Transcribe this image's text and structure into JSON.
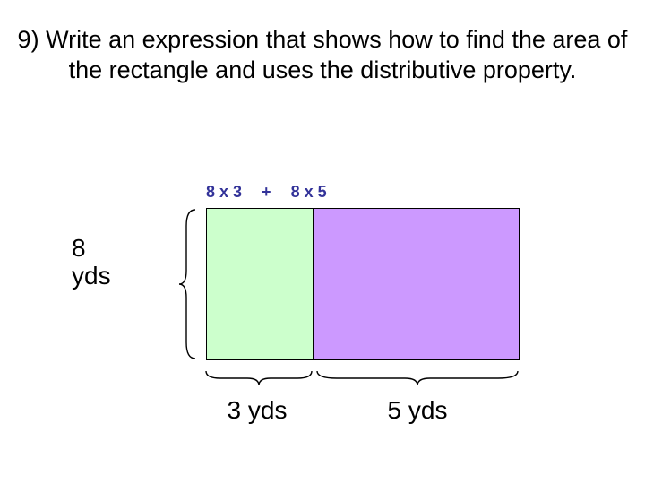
{
  "question": {
    "number": "9)",
    "text": "Write an expression that shows how to find the area of the rectangle and uses the distributive property."
  },
  "expression": {
    "left": "8 x 3",
    "op": "+",
    "right": "8 x 5"
  },
  "dims": {
    "height_label_a": "8",
    "height_label_b": "yds",
    "width_a": "3 yds",
    "width_b": "5 yds"
  },
  "colors": {
    "rect_a": "#ccffcc",
    "rect_b": "#cc99ff",
    "expr": "#333399"
  }
}
